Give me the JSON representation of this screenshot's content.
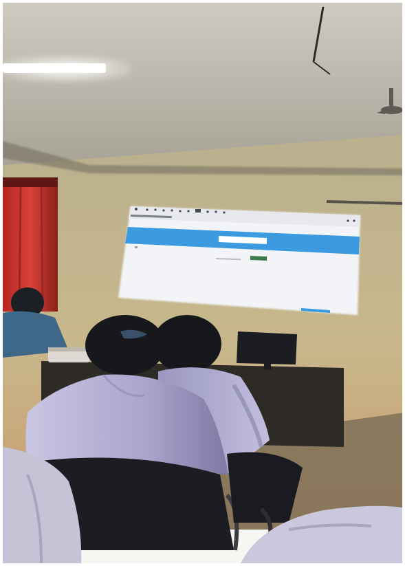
{
  "scene": {
    "description_kind": "classroom-photo",
    "colors": {
      "ceiling": "#c4c0b6",
      "ceiling_shadow": "#9c978d",
      "wall_upper": "#b8ae8e",
      "wall_lower": "#c9b487",
      "wall_warm": "#c99a68",
      "curtain": "#c8322b",
      "curtain_dark": "#7e1e1c",
      "screen_blue": "#3b9ae0",
      "screen_white": "#f4f6f9",
      "screen_bezel": "#2b2e35",
      "desk": "#2e2b27",
      "shirt": "#aeaad1",
      "shirt_shadow": "#7f7ba4",
      "hair": "#1a1c1e",
      "chair": "#1c1d22",
      "floor": "#7b6d56",
      "border": "#f7f6f3"
    },
    "icons": {
      "ceiling_light": "fluorescent-tube",
      "ceiling_fan": "ceiling-fan",
      "projection_screen": "projection-screen",
      "monitor": "computer-monitor"
    }
  }
}
